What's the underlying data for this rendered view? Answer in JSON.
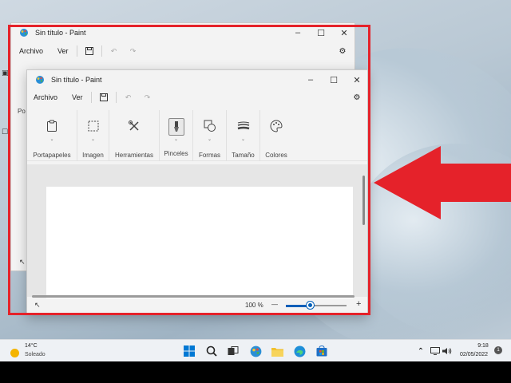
{
  "back_window": {
    "title": "Sin título - Paint",
    "menu": [
      "Archivo",
      "Ver"
    ],
    "partial_label": "Po"
  },
  "front_window": {
    "title": "Sin título - Paint",
    "menu": [
      "Archivo",
      "Ver"
    ],
    "ribbon_groups": [
      {
        "label": "Portapapeles",
        "icon": "clipboard-icon",
        "has_chevron": true
      },
      {
        "label": "Imagen",
        "icon": "select-icon",
        "has_chevron": true
      },
      {
        "label": "Herramientas",
        "icon": "tools-icon",
        "has_chevron": false
      },
      {
        "label": "Pinceles",
        "icon": "brush-icon",
        "has_chevron": true
      },
      {
        "label": "Formas",
        "icon": "shapes-icon",
        "has_chevron": true
      },
      {
        "label": "Tamaño",
        "icon": "size-icon",
        "has_chevron": true
      },
      {
        "label": "Colores",
        "icon": "colors-icon",
        "has_chevron": false
      }
    ],
    "status": {
      "zoom": "100 %",
      "zoom_out": "—",
      "zoom_in": "+",
      "zoom_fraction": 0.4
    }
  },
  "taskbar": {
    "weather_temp": "14°C",
    "weather_desc": "Soleado",
    "time": "9:18",
    "date": "02/05/2022",
    "notification_count": "1"
  },
  "colors": {
    "highlight": "#e5222a",
    "accent": "#005fb8"
  }
}
